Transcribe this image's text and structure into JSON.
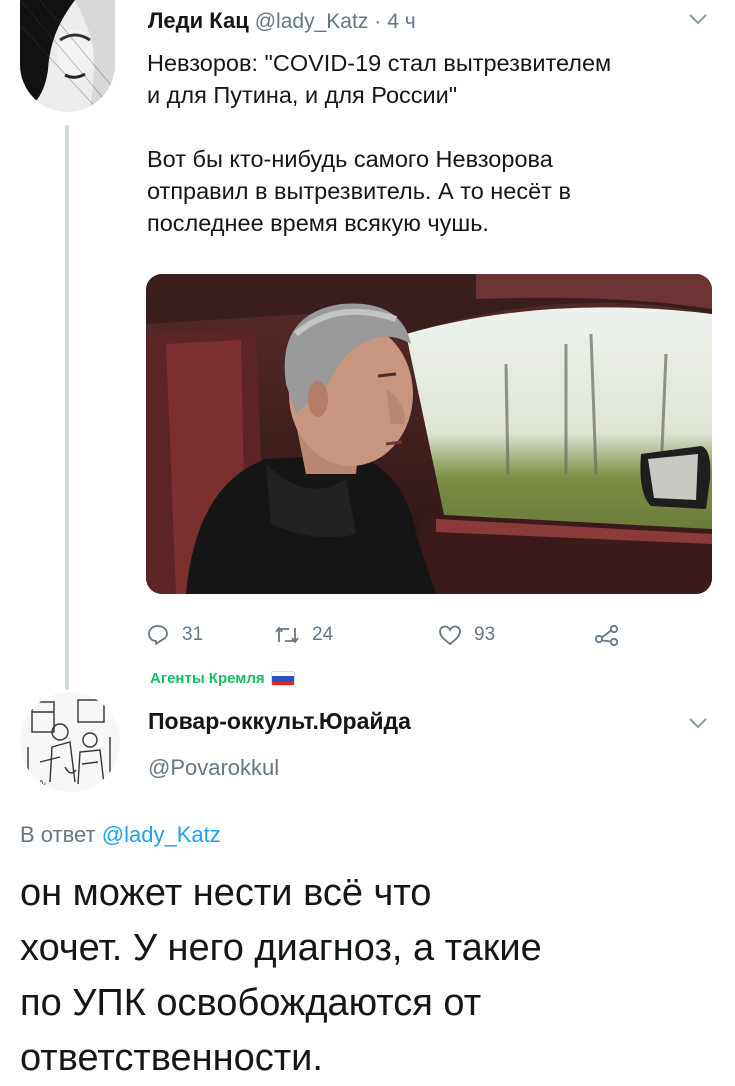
{
  "tweet": {
    "author_name": "Леди Кац",
    "author_handle": "@lady_Katz",
    "separator": "·",
    "time": "4 ч",
    "paragraph_1": "Невзоров: \"COVID-19 стал вытрезвителем\nи для Путина, и для России\"",
    "paragraph_2": "Вот бы кто-нибудь самого Невзорова\nотправил в вытрезвитель. А то несёт в\nпоследнее время всякую чушь.",
    "actions": {
      "replies": "31",
      "retweets": "24",
      "likes": "93"
    }
  },
  "reply_tweet": {
    "badge_label": "Агенты Кремля",
    "author_name": "Повар-оккульт.Юрайда",
    "author_handle": "@Povarokkul",
    "reply_prefix": "В ответ",
    "reply_mention": "@lady_Katz",
    "text": "он может нести всё что\nхочет. У него диагноз, а такие\nпо УПК освобождаются от\nответственности."
  },
  "icons": {
    "reply": "reply-icon",
    "retweet": "retweet-icon",
    "like": "heart-icon",
    "share": "share-icon",
    "more": "chevron-down-icon"
  },
  "colors": {
    "text": "#14171a",
    "secondary": "#657786",
    "link": "#1da1f2",
    "badge": "#17bf63",
    "thread_line": "#cfd9de"
  }
}
